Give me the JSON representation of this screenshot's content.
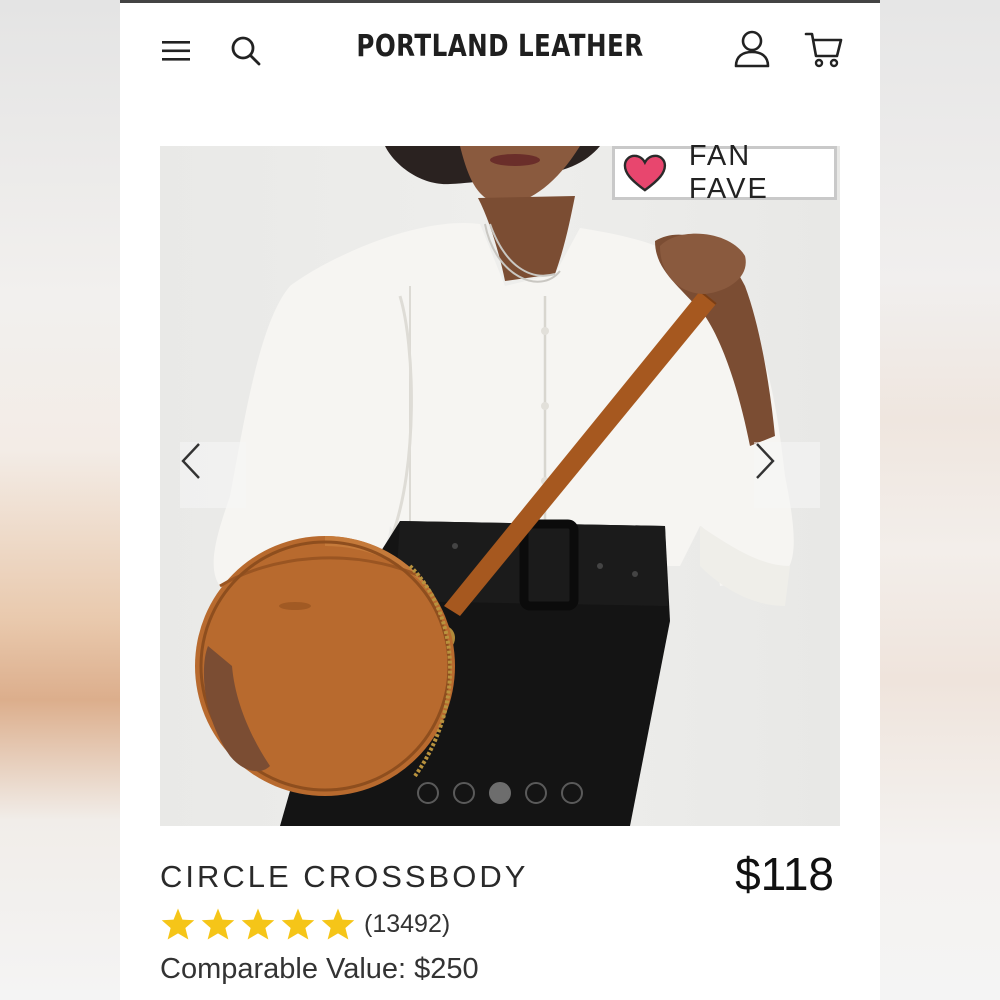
{
  "header": {
    "brand": "PORTLAND LEATHER",
    "icons": [
      "menu-icon",
      "search-icon",
      "account-icon",
      "cart-icon"
    ]
  },
  "hero": {
    "badge_label": "FAN FAVE",
    "badge_icon": "heart-icon",
    "badge_heart_color": "#e8466e",
    "carousel": {
      "total_slides": 5,
      "active_slide": 3
    }
  },
  "product": {
    "title": "CIRCLE CROSSBODY",
    "price": "$118",
    "rating": {
      "stars": 5,
      "review_count": "(13492)",
      "star_color": "#f5c518"
    },
    "comparable_value": "Comparable Value: $250"
  },
  "colors": {
    "leather": "#b86a2e",
    "text": "#222222"
  }
}
